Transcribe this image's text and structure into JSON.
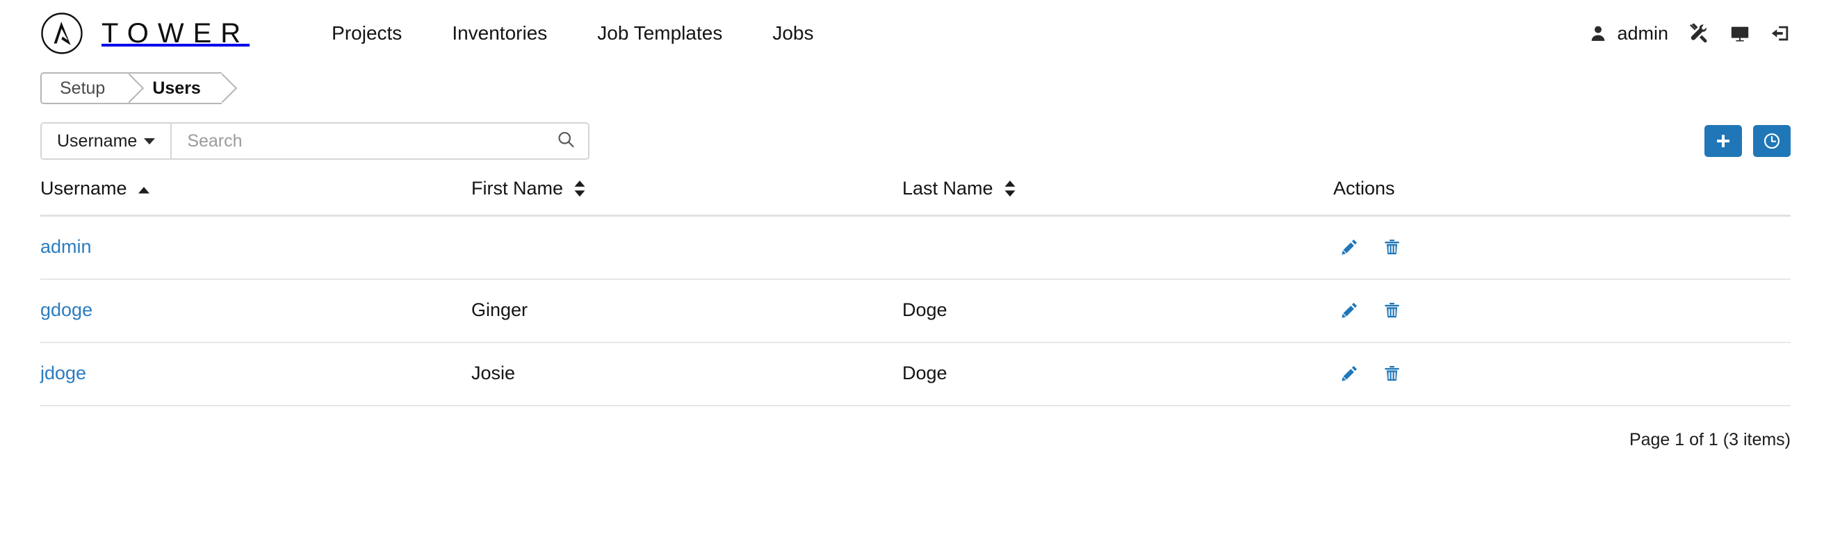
{
  "app": {
    "brand_name": "TOWER",
    "logo_icon": "ansible-a-logo"
  },
  "nav": {
    "items": [
      {
        "label": "Projects"
      },
      {
        "label": "Inventories"
      },
      {
        "label": "Job Templates"
      },
      {
        "label": "Jobs"
      }
    ]
  },
  "topright": {
    "user_label": "admin",
    "user_icon": "user-icon",
    "settings_icon": "wrench-screwdriver-icon",
    "console_icon": "monitor-icon",
    "logout_icon": "logout-icon"
  },
  "breadcrumb": {
    "items": [
      {
        "label": "Setup",
        "active": false
      },
      {
        "label": "Users",
        "active": true
      }
    ]
  },
  "toolbar": {
    "search_key_label": "Username",
    "search_key_icon": "chevron-down-icon",
    "search_placeholder": "Search",
    "search_value": "",
    "search_icon": "search-icon",
    "add_label": "+",
    "add_icon": "plus-icon",
    "activity_icon": "clock-icon",
    "accent_color": "#2077b8"
  },
  "table": {
    "columns": [
      {
        "label": "Username",
        "sort": "asc",
        "sort_icon": "caret-up-icon"
      },
      {
        "label": "First Name",
        "sort": "none",
        "sort_icon": "caret-updown-icon"
      },
      {
        "label": "Last Name",
        "sort": "none",
        "sort_icon": "caret-updown-icon"
      },
      {
        "label": "Actions",
        "sort": null,
        "sort_icon": null
      }
    ],
    "rows": [
      {
        "username": "admin",
        "first_name": "",
        "last_name": "",
        "edit_icon": "pencil-icon",
        "delete_icon": "trash-icon"
      },
      {
        "username": "gdoge",
        "first_name": "Ginger",
        "last_name": "Doge",
        "edit_icon": "pencil-icon",
        "delete_icon": "trash-icon"
      },
      {
        "username": "jdoge",
        "first_name": "Josie",
        "last_name": "Doge",
        "edit_icon": "pencil-icon",
        "delete_icon": "trash-icon"
      }
    ],
    "link_color": "#2c7cbf",
    "action_color": "#2077b8"
  },
  "footer": {
    "pagination_text": "Page 1 of 1 (3 items)"
  }
}
